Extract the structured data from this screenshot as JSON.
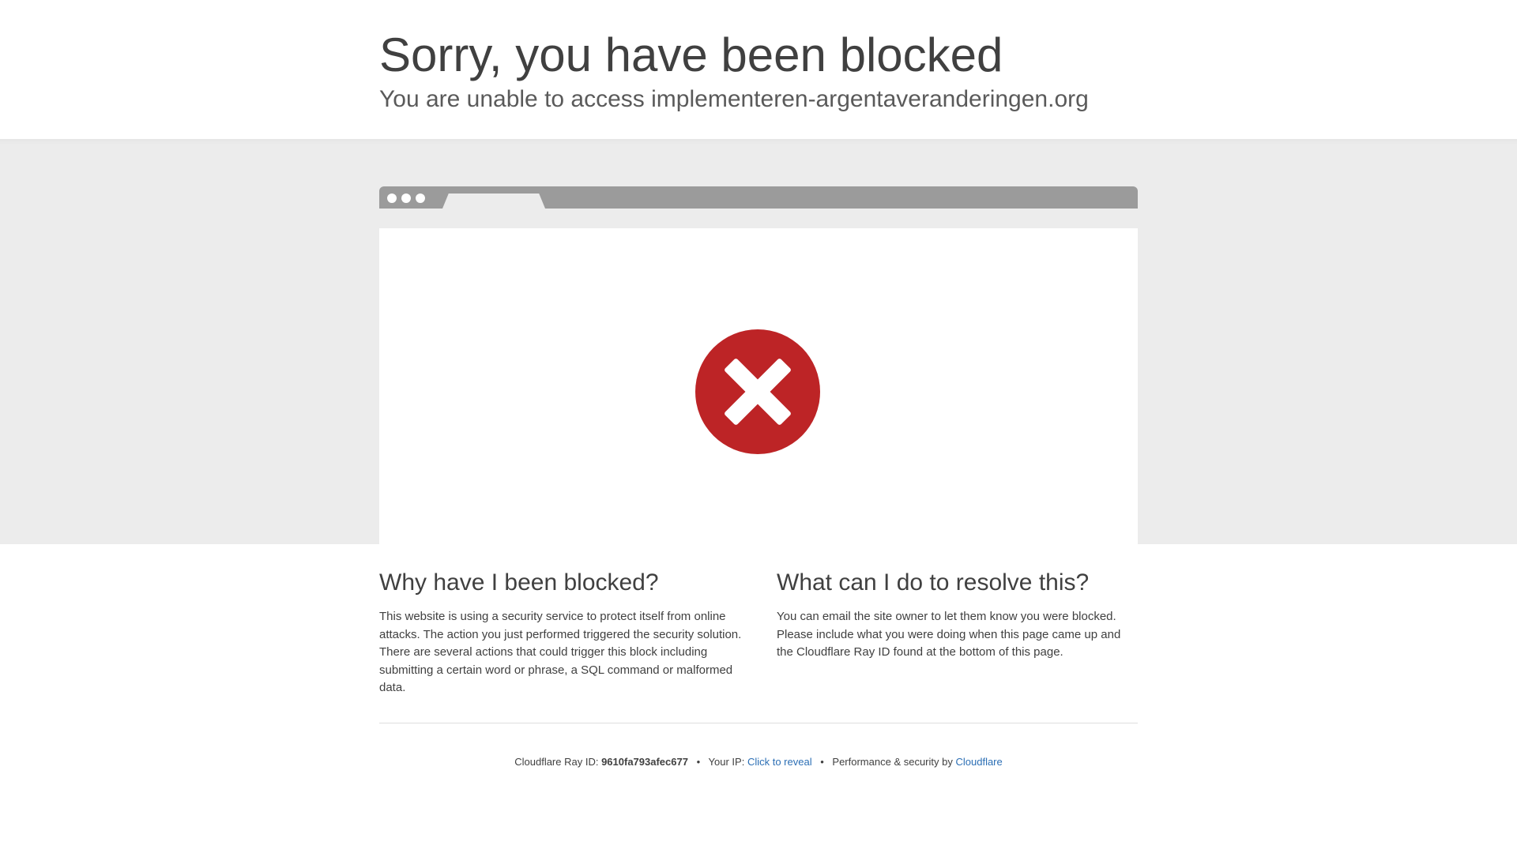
{
  "header": {
    "title": "Sorry, you have been blocked",
    "subtitle": "You are unable to access implementeren-argentaveranderingen.org"
  },
  "illustration": {
    "icon": "blocked-x-circle-icon",
    "icon_color": "#bd2426"
  },
  "why": {
    "heading": "Why have I been blocked?",
    "body": "This website is using a security service to protect itself from online attacks. The action you just performed triggered the security solution. There are several actions that could trigger this block including submitting a certain word or phrase, a SQL command or malformed data."
  },
  "resolve": {
    "heading": "What can I do to resolve this?",
    "body": "You can email the site owner to let them know you were blocked. Please include what you were doing when this page came up and the Cloudflare Ray ID found at the bottom of this page."
  },
  "footer": {
    "ray_label": "Cloudflare Ray ID:",
    "ray_id": "9610fa793afec677",
    "separator": "•",
    "ip_label": "Your IP:",
    "ip_link": "Click to reveal",
    "perf_label": "Performance & security by",
    "cloudflare_link": "Cloudflare",
    "link_color": "#2c6fb5"
  }
}
